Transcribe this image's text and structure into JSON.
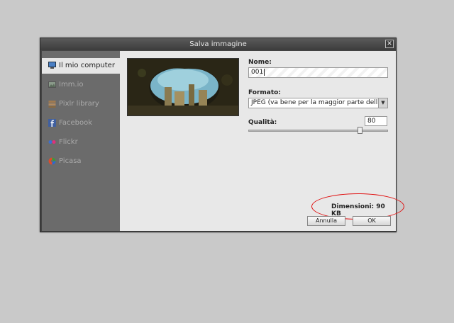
{
  "dialog": {
    "title": "Salva immagine",
    "close_symbol": "✕"
  },
  "sidebar": {
    "items": [
      {
        "label": "Il mio computer",
        "icon": "computer-icon",
        "active": true
      },
      {
        "label": "Imm.io",
        "icon": "image-icon",
        "active": false
      },
      {
        "label": "Pixlr library",
        "icon": "library-icon",
        "active": false
      },
      {
        "label": "Facebook",
        "icon": "facebook-icon",
        "active": false
      },
      {
        "label": "Flickr",
        "icon": "flickr-icon",
        "active": false
      },
      {
        "label": "Picasa",
        "icon": "picasa-icon",
        "active": false
      }
    ]
  },
  "form": {
    "name_label": "Nome:",
    "name_value": "001",
    "format_label": "Formato:",
    "format_value": "JPEG (va bene per la maggior parte dell",
    "quality_label": "Qualità:",
    "quality_value": "80",
    "size_text": "Dimensioni: 90 KB"
  },
  "buttons": {
    "cancel": "Annulla",
    "ok": "OK"
  },
  "colors": {
    "highlight_ellipse": "#e01010",
    "sidebar_active_bg": "#e6e6e6"
  }
}
